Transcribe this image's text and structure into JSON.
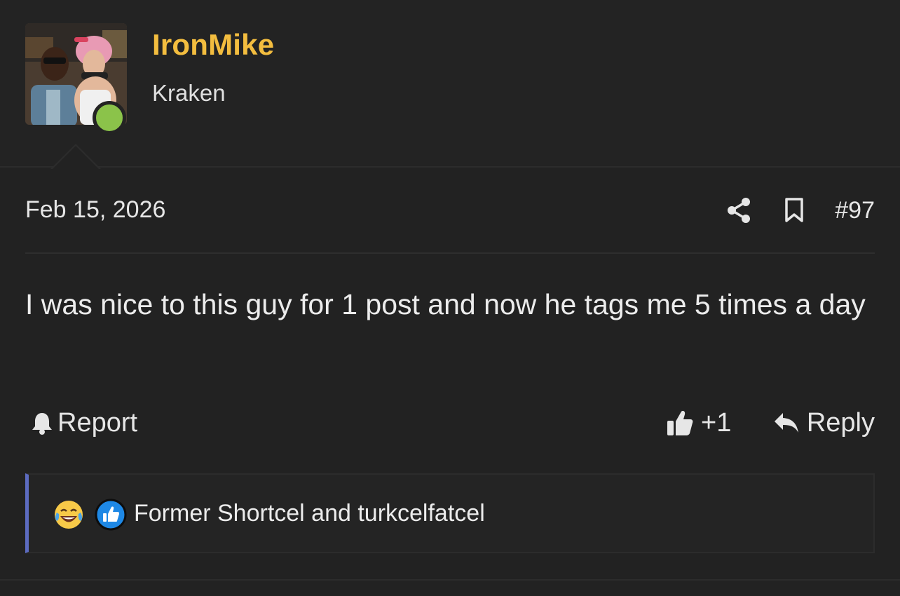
{
  "user": {
    "name": "IronMike",
    "title": "Kraken",
    "online": true
  },
  "post": {
    "date": "Feb 15, 2026",
    "number": "#97",
    "body": "I was nice to this guy for 1 post and now he tags me 5 times a day"
  },
  "actions": {
    "report_label": "Report",
    "like_count": "+1",
    "reply_label": "Reply"
  },
  "reactions": {
    "icons": [
      "crying-laughing-emoji-icon",
      "like-reaction-icon"
    ],
    "text": "Former Shortcel and turkcelfatcel"
  },
  "colors": {
    "background": "#222222",
    "username": "#f3bd3f",
    "online": "#8bc34a",
    "reaction_bar_accent": "#5c6bc0",
    "like_blue": "#1e88e5"
  }
}
